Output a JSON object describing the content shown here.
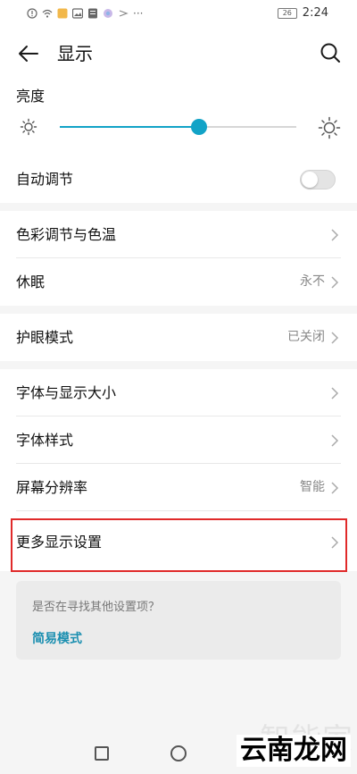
{
  "status_bar": {
    "time": "2:24",
    "battery_level": "26",
    "more_indicator": "···",
    "icons": [
      "alert-icon",
      "wifi-icon",
      "notification-icon",
      "gallery-icon",
      "notification-icon",
      "app-icon",
      "cast-icon"
    ]
  },
  "header": {
    "title": "显示",
    "back_icon": "arrow-left-icon",
    "search_icon": "search-icon"
  },
  "brightness": {
    "label": "亮度",
    "level": 0.59,
    "accent_color": "#12a3c7"
  },
  "rows": {
    "auto_adjust": {
      "label": "自动调节",
      "toggle_on": false
    },
    "color_temp": {
      "label": "色彩调节与色温"
    },
    "sleep": {
      "label": "休眠",
      "value": "永不"
    },
    "eye_comfort": {
      "label": "护眼模式",
      "value": "已关闭"
    },
    "font_size": {
      "label": "字体与显示大小"
    },
    "font_style": {
      "label": "字体样式"
    },
    "resolution": {
      "label": "屏幕分辨率",
      "value": "智能"
    },
    "more_display": {
      "label": "更多显示设置"
    }
  },
  "suggestion": {
    "question": "是否在寻找其他设置项？",
    "link": "简易模式",
    "link_color": "#1b8fb0"
  },
  "watermark": {
    "top_text": "智能家",
    "bottom_text": "云南龙网"
  },
  "highlight_color": "#e02a2a"
}
